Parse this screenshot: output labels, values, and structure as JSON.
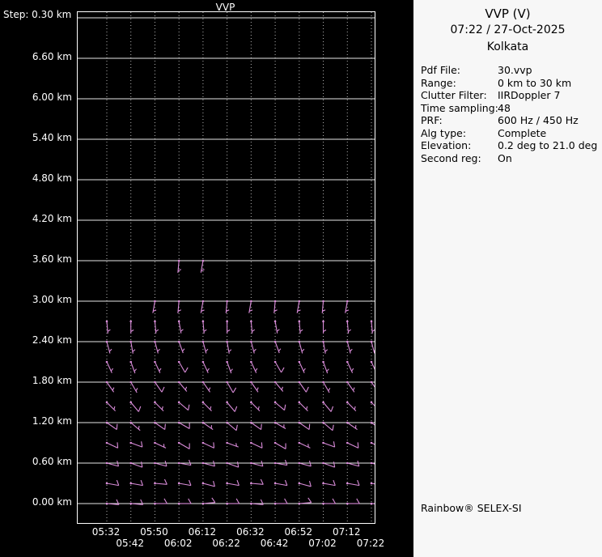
{
  "plot": {
    "title": "VVP",
    "step_label": "Step: 0.30 km"
  },
  "chart_data": {
    "type": "wind-barb-profile",
    "title": "VVP",
    "xlabel": "time",
    "ylabel": "height",
    "height_step_km": 0.3,
    "y_range_km": [
      0.0,
      7.2
    ],
    "y_tick_values_km": [
      6.6,
      6.0,
      5.4,
      4.8,
      4.2,
      3.6,
      3.0,
      2.4,
      1.8,
      1.2,
      0.6,
      0.0
    ],
    "y_tick_labels": [
      "6.60 km",
      "6.00 km",
      "5.40 km",
      "4.80 km",
      "4.20 km",
      "3.60 km",
      "3.00 km",
      "2.40 km",
      "1.80 km",
      "1.20 km",
      "0.60 km",
      "0.00 km"
    ],
    "x_times": [
      "05:32",
      "05:42",
      "05:50",
      "06:02",
      "06:12",
      "06:22",
      "06:32",
      "06:42",
      "06:52",
      "07:02",
      "07:12",
      "07:22"
    ],
    "x_tick_rows": [
      [
        "05:32",
        "05:50",
        "06:12",
        "06:32",
        "06:52",
        "07:12"
      ],
      [
        "05:42",
        "06:02",
        "06:22",
        "06:42",
        "07:02",
        "07:22"
      ]
    ],
    "grid": {
      "horizontal_solid_step_km": 0.6,
      "vertical_dotted_per_time": true
    },
    "barb_color": "#d98cd9",
    "grid_color": "#ffffff",
    "levels": [
      {
        "h_km": 0.0,
        "dir_deg": [
          95,
          95,
          90,
          90,
          85,
          90,
          95,
          90,
          85,
          90,
          90,
          95
        ],
        "spd_kt": [
          10,
          10,
          10,
          10,
          10,
          10,
          10,
          10,
          10,
          10,
          10,
          10
        ]
      },
      {
        "h_km": 0.3,
        "dir_deg": [
          100,
          100,
          95,
          100,
          105,
          100,
          95,
          100,
          105,
          100,
          100,
          100
        ],
        "spd_kt": [
          10,
          10,
          10,
          10,
          10,
          10,
          10,
          10,
          10,
          10,
          10,
          10
        ]
      },
      {
        "h_km": 0.6,
        "dir_deg": [
          105,
          110,
          105,
          100,
          105,
          110,
          105,
          100,
          105,
          110,
          105,
          105
        ],
        "spd_kt": [
          10,
          10,
          10,
          10,
          10,
          10,
          10,
          10,
          10,
          10,
          10,
          10
        ]
      },
      {
        "h_km": 0.9,
        "dir_deg": [
          115,
          110,
          115,
          120,
          115,
          110,
          115,
          120,
          115,
          110,
          115,
          115
        ],
        "spd_kt": [
          10,
          10,
          5,
          10,
          10,
          5,
          10,
          10,
          5,
          10,
          10,
          10
        ]
      },
      {
        "h_km": 1.2,
        "dir_deg": [
          125,
          130,
          125,
          120,
          125,
          130,
          125,
          120,
          125,
          130,
          125,
          125
        ],
        "spd_kt": [
          10,
          5,
          10,
          10,
          5,
          10,
          10,
          5,
          10,
          10,
          5,
          10
        ]
      },
      {
        "h_km": 1.5,
        "dir_deg": [
          135,
          140,
          135,
          130,
          135,
          140,
          135,
          130,
          135,
          140,
          135,
          135
        ],
        "spd_kt": [
          5,
          10,
          5,
          10,
          5,
          10,
          5,
          10,
          5,
          10,
          5,
          10
        ]
      },
      {
        "h_km": 1.8,
        "dir_deg": [
          145,
          150,
          145,
          140,
          145,
          150,
          145,
          140,
          145,
          150,
          145,
          145
        ],
        "spd_kt": [
          5,
          5,
          10,
          5,
          5,
          10,
          5,
          5,
          10,
          5,
          5,
          10
        ]
      },
      {
        "h_km": 2.1,
        "dir_deg": [
          155,
          160,
          155,
          150,
          155,
          160,
          155,
          150,
          155,
          160,
          155,
          155
        ],
        "spd_kt": [
          5,
          5,
          5,
          10,
          5,
          5,
          5,
          10,
          5,
          5,
          5,
          5
        ]
      },
      {
        "h_km": 2.4,
        "dir_deg": [
          165,
          170,
          165,
          160,
          165,
          170,
          165,
          160,
          165,
          170,
          165,
          165
        ],
        "spd_kt": [
          5,
          5,
          5,
          5,
          5,
          5,
          5,
          5,
          5,
          5,
          5,
          5
        ]
      },
      {
        "h_km": 2.7,
        "dir_deg": [
          175,
          180,
          175,
          170,
          175,
          180,
          175,
          170,
          175,
          180,
          175,
          175
        ],
        "spd_kt": [
          5,
          5,
          5,
          5,
          5,
          5,
          5,
          5,
          5,
          5,
          5,
          5
        ]
      },
      {
        "h_km": 3.0,
        "dir_deg": [
          null,
          null,
          190,
          185,
          190,
          185,
          190,
          185,
          190,
          185,
          190,
          null
        ],
        "spd_kt": [
          null,
          null,
          5,
          5,
          5,
          5,
          5,
          5,
          5,
          5,
          5,
          null
        ]
      },
      {
        "h_km": 3.6,
        "dir_deg": [
          null,
          null,
          null,
          185,
          190,
          null,
          null,
          null,
          null,
          null,
          null,
          null
        ],
        "spd_kt": [
          null,
          null,
          null,
          5,
          5,
          null,
          null,
          null,
          null,
          null,
          null,
          null
        ]
      }
    ]
  },
  "panel": {
    "title": "VVP (V)",
    "datetime": "07:22 / 27-Oct-2025",
    "station": "Kolkata",
    "info_rows": [
      {
        "label": "Pdf File:",
        "value": "30.vvp"
      },
      {
        "label": "Range:",
        "value": "0 km to 30 km"
      },
      {
        "label": "Clutter Filter:",
        "value": "IIRDoppler 7"
      },
      {
        "label": "Time sampling:",
        "value": "48"
      },
      {
        "label": "PRF:",
        "value": "600 Hz / 450 Hz"
      },
      {
        "label": "Alg type:",
        "value": "Complete"
      },
      {
        "label": "Elevation:",
        "value": "0.2 deg to 21.0 deg"
      },
      {
        "label": "Second reg:",
        "value": "On"
      }
    ],
    "footer": "Rainbow® SELEX-SI"
  }
}
